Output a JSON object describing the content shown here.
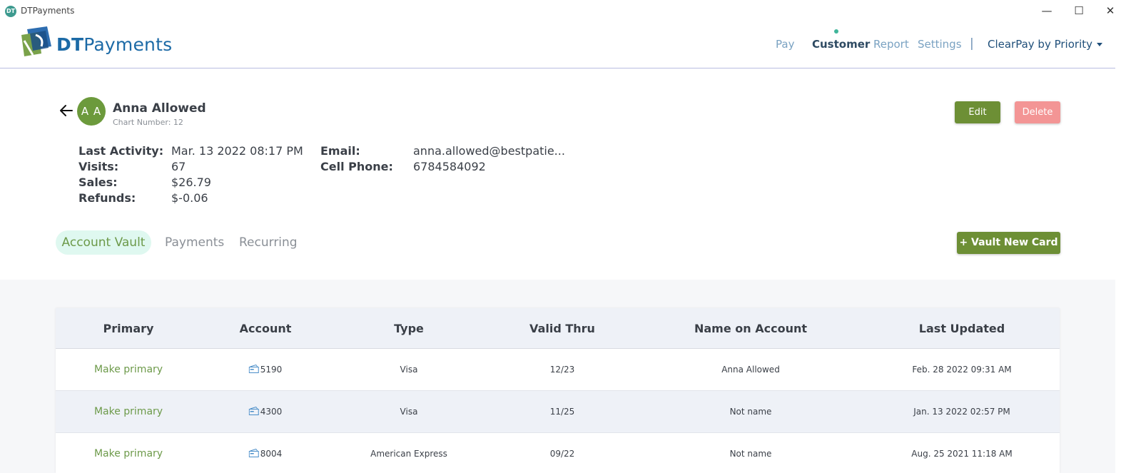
{
  "window": {
    "icon_text": "DT",
    "title": "DTPayments",
    "minimize_glyph": "—",
    "maximize_glyph": "☐",
    "close_glyph": "✕"
  },
  "header": {
    "logo_bold": "DT",
    "logo_rest": "Payments",
    "nav": {
      "pay": "Pay",
      "customer": "Customer",
      "report": "Report",
      "settings": "Settings",
      "separator": "|"
    },
    "account_name": "ClearPay by Priority",
    "active_dot_color": "#3fb59a"
  },
  "customer": {
    "avatar_initials": "A A",
    "name": "Anna Allowed",
    "chart_number": "Chart Number: 12",
    "stats": {
      "last_activity_label": "Last Activity:",
      "last_activity": "Mar. 13 2022 08:17 PM",
      "visits_label": "Visits:",
      "visits": "67",
      "sales_label": "Sales:",
      "sales": "$26.79",
      "refunds_label": "Refunds:",
      "refunds": "$-0.06",
      "email_label": "Email:",
      "email": "anna.allowed@bestpatie...",
      "cell_phone_label": "Cell Phone:",
      "cell_phone": "6784584092"
    },
    "edit_label": "Edit",
    "delete_label": "Delete"
  },
  "tabs": {
    "account_vault": "Account Vault",
    "payments": "Payments",
    "recurring": "Recurring",
    "vault_new_card": "+ Vault New Card"
  },
  "table": {
    "headers": {
      "primary": "Primary",
      "account": "Account",
      "type": "Type",
      "valid_thru": "Valid Thru",
      "name_on_account": "Name on Account",
      "last_updated": "Last Updated"
    },
    "rows": [
      {
        "primary": "Make primary",
        "account": "5190",
        "type": "Visa",
        "valid_thru": "12/23",
        "name": "Anna Allowed",
        "updated": "Feb. 28 2022 09:31 AM"
      },
      {
        "primary": "Make primary",
        "account": "4300",
        "type": "Visa",
        "valid_thru": "11/25",
        "name": "Not name",
        "updated": "Jan. 13 2022 02:57 PM"
      },
      {
        "primary": "Make primary",
        "account": "8004",
        "type": "American Express",
        "valid_thru": "09/22",
        "name": "Not name",
        "updated": "Aug. 25 2021 11:18 AM"
      }
    ]
  },
  "colors": {
    "brand_blue": "#1c6aa6",
    "accent_green": "#6d8f35",
    "delete_red": "#f39595",
    "tab_active_bg": "#dff8f0"
  },
  "icons": {
    "back": "arrow-left-icon",
    "card": "credit-card-icon",
    "dropdown": "chevron-down-icon"
  }
}
